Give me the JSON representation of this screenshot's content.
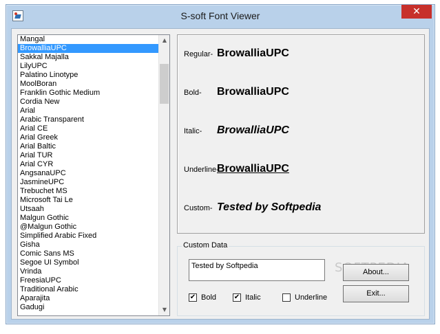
{
  "window": {
    "title": "S-soft Font Viewer",
    "close_glyph": "✕"
  },
  "font_list": {
    "selected_index": 1,
    "items": [
      "Mangal",
      "BrowalliaUPC",
      "Sakkal Majalla",
      "LilyUPC",
      "Palatino Linotype",
      "MoolBoran",
      "Franklin Gothic Medium",
      "Cordia New",
      "Arial",
      "Arabic Transparent",
      "Arial CE",
      "Arial Greek",
      "Arial Baltic",
      "Arial TUR",
      "Arial CYR",
      "AngsanaUPC",
      "JasmineUPC",
      "Trebuchet MS",
      "Microsoft Tai Le",
      "Utsaah",
      "Malgun Gothic",
      "@Malgun Gothic",
      "Simplified Arabic Fixed",
      "Gisha",
      "Comic Sans MS",
      "Segoe UI Symbol",
      "Vrinda",
      "FreesiaUPC",
      "Traditional Arabic",
      "Aparajita",
      "Gadugi"
    ],
    "scroll_up_glyph": "▲",
    "scroll_down_glyph": "▼"
  },
  "preview": {
    "regular_label": "Regular-",
    "regular_sample": "BrowalliaUPC",
    "bold_label": "Bold-",
    "bold_sample": "BrowalliaUPC",
    "italic_label": "Italic-",
    "italic_sample": "BrowalliaUPC",
    "underline_label": "Underline-",
    "underline_sample": "BrowalliaUPC",
    "custom_label": "Custom-",
    "custom_sample": "Tested by Softpedia"
  },
  "custom_data": {
    "group_title": "Custom Data",
    "text_value": "Tested by Softpedia",
    "bold_label": "Bold",
    "bold_checked": true,
    "italic_label": "Italic",
    "italic_checked": true,
    "underline_label": "Underline",
    "underline_checked": false,
    "check_glyph": "✔",
    "about_label": "About...",
    "exit_label": "Exit...",
    "watermark_text": "SOFTPEDIA"
  }
}
